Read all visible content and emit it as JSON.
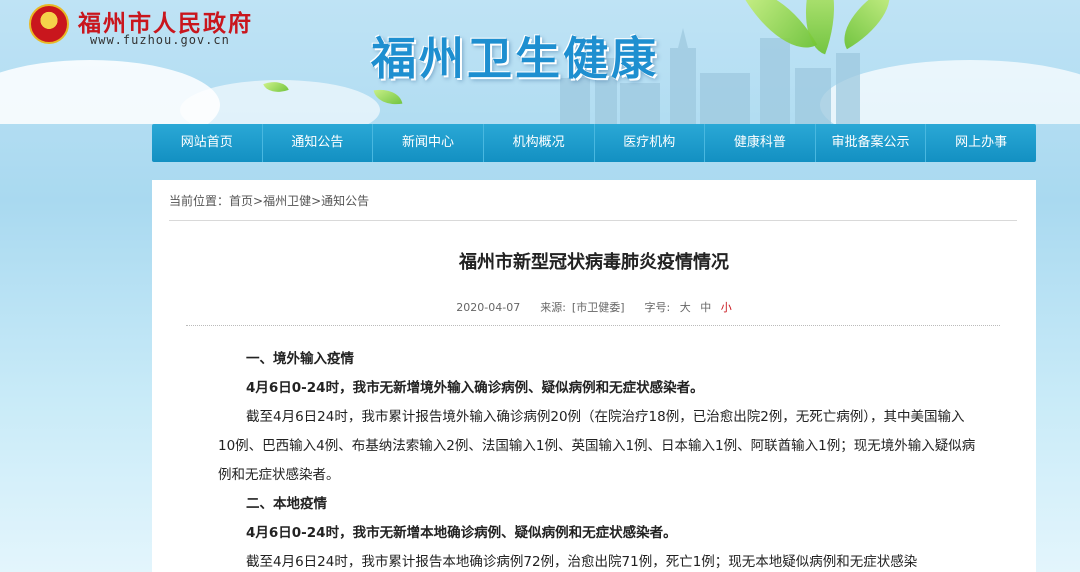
{
  "header": {
    "gov_name": "福州市人民政府",
    "gov_url": "www.fuzhou.gov.cn",
    "site_title": "福州卫生健康"
  },
  "nav": {
    "items": [
      "网站首页",
      "通知公告",
      "新闻中心",
      "机构概况",
      "医疗机构",
      "健康科普",
      "审批备案公示",
      "网上办事"
    ]
  },
  "breadcrumb": {
    "prefix": "当前位置：",
    "home": "首页",
    "sep": ">",
    "level2": "福州卫健",
    "level3": "通知公告"
  },
  "article": {
    "title": "福州市新型冠状病毒肺炎疫情情况",
    "date": "2020-04-07",
    "source_label": "来源:",
    "source": "[市卫健委]",
    "fontsize_label": "字号:",
    "size_large": "大",
    "size_medium": "中",
    "size_small": "小",
    "section1_heading": "一、境外输入疫情",
    "section1_lead": "4月6日0-24时，我市无新增境外输入确诊病例、疑似病例和无症状感染者。",
    "section1_para": "截至4月6日24时，我市累计报告境外输入确诊病例20例（在院治疗18例，已治愈出院2例，无死亡病例），其中美国输入10例、巴西输入4例、布基纳法索输入2例、法国输入1例、英国输入1例、日本输入1例、阿联酋输入1例；现无境外输入疑似病例和无症状感染者。",
    "section2_heading": "二、本地疫情",
    "section2_lead": "4月6日0-24时，我市无新增本地确诊病例、疑似病例和无症状感染者。",
    "section2_para": "截至4月6日24时，我市累计报告本地确诊病例72例，治愈出院71例，死亡1例；现无本地疑似病例和无症状感染"
  },
  "colors": {
    "nav_bg": "#1a9bcc",
    "gov_red": "#c9161d",
    "title_blue": "#1e8fd0"
  }
}
